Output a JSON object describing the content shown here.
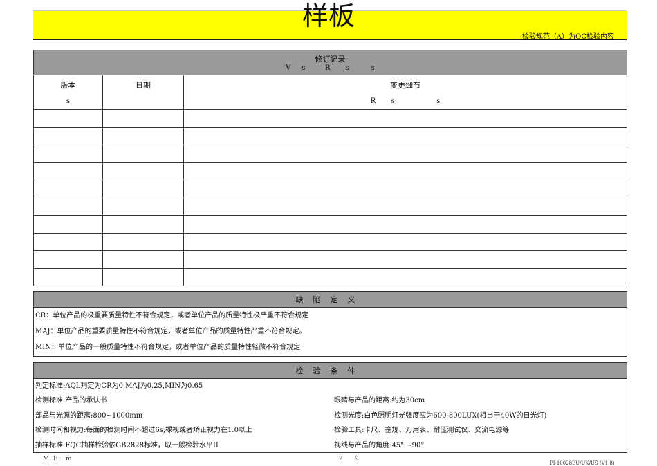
{
  "header": {
    "title": "样板",
    "subtitle": "检验规范（A）为QC检验内容"
  },
  "revision": {
    "title": "修订记录",
    "title_en": "V     s         R       s          s",
    "col_version": "版本",
    "col_version_en": "s",
    "col_date": "日期",
    "col_detail": "变更细节",
    "col_detail_en": "R       s                   s",
    "rows": 10
  },
  "defects": {
    "title": "缺陷定义",
    "lines": [
      "CR：单位产品的极重要质量特性不符合规定，或者单位产品的质量特性极严重不符合规定",
      "MAJ：单位产品的重要质量特性不符合规定，或者单位产品的质量特性严重不符合规定。",
      "MIN：单位产品的一般质量特性不符合规定，或者单位产品的质量特性轻微不符合规定"
    ]
  },
  "conditions": {
    "title": "检验条件",
    "row0": "判定标准:AQL判定为CR为0,MAJ为0.25,MIN为0.65",
    "left": [
      "检测标准:产品的承认书",
      "部品与光源的距离:800~1000mm",
      "检测时间和视力:每面的检测时间不超过6s,裸视或者矫正视力在1.0以上",
      "抽样标准:FQC抽样检验依GB2828标准，取一般检验水平II"
    ],
    "right": [
      "眼睛与产品的距离:约为30cm",
      "检测光度:白色照明灯光强度应为600-800LUX(相当于40W的日光灯)",
      "检验工具:卡尺、塞规、万用表、耐压测试仪、交流电源等",
      "视线与产品的角度:45° ~90°"
    ]
  },
  "footer": {
    "left": "M  E    m",
    "mid": "2      9",
    "right": "PI-10028EU/UK/US (V1.8)"
  }
}
